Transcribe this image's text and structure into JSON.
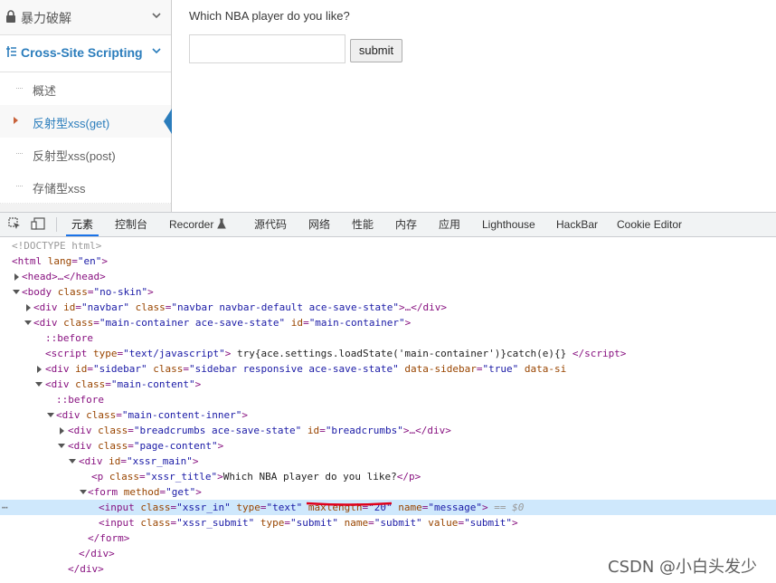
{
  "sidebar": {
    "top_item": {
      "label": "暴力破解"
    },
    "xss_item": {
      "label": "Cross-Site Scripting"
    },
    "children": [
      {
        "label": "概述"
      },
      {
        "label": "反射型xss(get)"
      },
      {
        "label": "反射型xss(post)"
      },
      {
        "label": "存储型xss"
      }
    ]
  },
  "main": {
    "title": "Which NBA player do you like?",
    "input_value": "",
    "submit_label": "submit"
  },
  "devtools": {
    "tabs": [
      "元素",
      "控制台",
      "Recorder",
      "源代码",
      "网络",
      "性能",
      "内存",
      "应用",
      "Lighthouse",
      "HackBar",
      "Cookie Editor"
    ],
    "active_tab": "元素",
    "dom": {
      "l1": "<!DOCTYPE html>",
      "l2_tag": "<html",
      "l2_an": " lang",
      "l2_av": "\"en\"",
      "l3": "<head>…</head>",
      "l4_tag": "<body",
      "l4_an": " class",
      "l4_av": "\"no-skin\"",
      "l5_an1": " id",
      "l5_av1": "\"navbar\"",
      "l5_an2": " class",
      "l5_av2": "\"navbar navbar-default          ace-save-state\"",
      "l6_an1": " class",
      "l6_av1": "\"main-container ace-save-state\"",
      "l6_an2": " id",
      "l6_av2": "\"main-container\"",
      "before": "::before",
      "l8_an": " type",
      "l8_av": "\"text/javascript\"",
      "l8_tx": " try{ace.settings.loadState('main-container')}catch(e){} ",
      "l9_an1": " id",
      "l9_av1": "\"sidebar\"",
      "l9_an2": " class",
      "l9_av2": "\"sidebar                  responsive                    ace-save-state\"",
      "l9_an3": " data-sidebar",
      "l9_av3": "\"true\"",
      "l9_an4": " data-si",
      "l10_an": " class",
      "l10_av": "\"main-content\"",
      "l12_an": " class",
      "l12_av": "\"main-content-inner\"",
      "l13_an1": " class",
      "l13_av1": "\"breadcrumbs ace-save-state\"",
      "l13_an2": " id",
      "l13_av2": "\"breadcrumbs\"",
      "l14_an": " class",
      "l14_av": "\"page-content\"",
      "l15_an": " id",
      "l15_av": "\"xssr_main\"",
      "l16_an": " class",
      "l16_av": "\"xssr_title\"",
      "l16_tx": "Which NBA player do you like?",
      "l17_an": " method",
      "l17_av": "\"get\"",
      "l18_an1": " class",
      "l18_av1": "\"xssr_in\"",
      "l18_an2": " type",
      "l18_av2": "\"text\"",
      "l18_an3": " maxlength",
      "l18_av3": "\"20\"",
      "l18_an4": " name",
      "l18_av4": "\"message\"",
      "l18_eq": " == $0",
      "l19_an1": " class",
      "l19_av1": "\"xssr_submit\"",
      "l19_an2": " type",
      "l19_av2": "\"submit\"",
      "l19_an3": " name",
      "l19_av3": "\"submit\"",
      "l19_an4": " value",
      "l19_av4": "\"submit\""
    }
  },
  "watermark": "CSDN @小白头发少",
  "colors": {
    "accent": "#2b7dbc",
    "selected_row": "#cfe8fc",
    "underline": "#e0001b"
  }
}
